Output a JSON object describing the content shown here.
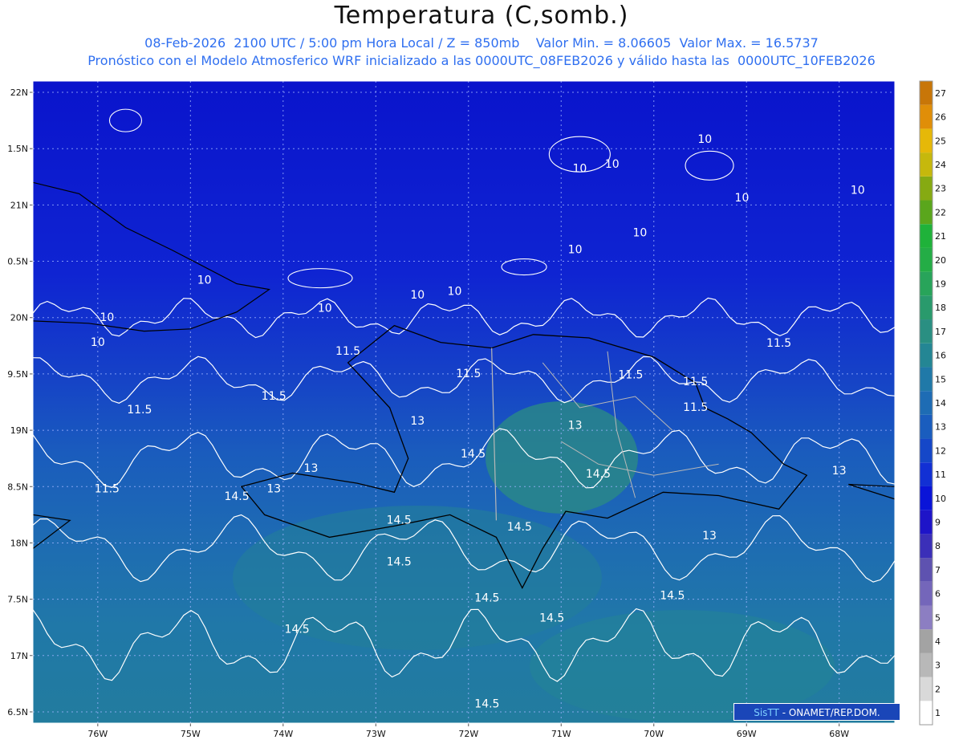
{
  "header": {
    "title": "Temperatura (C,somb.)",
    "line1": "08-Feb-2026  2100 UTC / 5:00 pm Hora Local / Z = 850mb    Valor Min. = 8.06605  Valor Max. = 16.5737",
    "line2": "Pronóstico con el Modelo Atmosferico WRF inicializado a las 0000UTC_08FEB2026 y válido hasta las  0000UTC_10FEB2026"
  },
  "map": {
    "lon_range": [
      -76.7,
      -67.4
    ],
    "lat_range": [
      16.4,
      22.1
    ],
    "lon_ticks": [
      {
        "value": -76,
        "label": "76W"
      },
      {
        "value": -75,
        "label": "75W"
      },
      {
        "value": -74,
        "label": "74W"
      },
      {
        "value": -73,
        "label": "73W"
      },
      {
        "value": -72,
        "label": "72W"
      },
      {
        "value": -71,
        "label": "71W"
      },
      {
        "value": -70,
        "label": "70W"
      },
      {
        "value": -69,
        "label": "69W"
      },
      {
        "value": -68,
        "label": "68W"
      }
    ],
    "lat_ticks": [
      {
        "value": 22,
        "label": "22N"
      },
      {
        "value": 21.5,
        "label": "1.5N"
      },
      {
        "value": 21,
        "label": "21N"
      },
      {
        "value": 20.5,
        "label": "0.5N"
      },
      {
        "value": 20,
        "label": "20N"
      },
      {
        "value": 19.5,
        "label": "9.5N"
      },
      {
        "value": 19,
        "label": "19N"
      },
      {
        "value": 18.5,
        "label": "8.5N"
      },
      {
        "value": 18,
        "label": "18N"
      },
      {
        "value": 17.5,
        "label": "7.5N"
      },
      {
        "value": 17,
        "label": "17N"
      },
      {
        "value": 16.5,
        "label": "6.5N"
      }
    ],
    "contour_labels": [
      {
        "text": "10",
        "lon": -75.9,
        "lat": 19.97
      },
      {
        "text": "10",
        "lon": -74.85,
        "lat": 20.3
      },
      {
        "text": "10",
        "lon": -73.55,
        "lat": 20.05
      },
      {
        "text": "10",
        "lon": -72.55,
        "lat": 20.17
      },
      {
        "text": "10",
        "lon": -72.15,
        "lat": 20.2
      },
      {
        "text": "10",
        "lon": -70.85,
        "lat": 20.57
      },
      {
        "text": "10",
        "lon": -70.15,
        "lat": 20.72
      },
      {
        "text": "10",
        "lon": -70.8,
        "lat": 21.29
      },
      {
        "text": "10",
        "lon": -70.45,
        "lat": 21.33
      },
      {
        "text": "10",
        "lon": -69.45,
        "lat": 21.55
      },
      {
        "text": "10",
        "lon": -69.05,
        "lat": 21.03
      },
      {
        "text": "10",
        "lon": -67.8,
        "lat": 21.1
      },
      {
        "text": "10",
        "lon": -76.0,
        "lat": 19.75
      },
      {
        "text": "11.5",
        "lon": -73.3,
        "lat": 19.67
      },
      {
        "text": "11.5",
        "lon": -72.0,
        "lat": 19.47
      },
      {
        "text": "11.5",
        "lon": -74.1,
        "lat": 19.27
      },
      {
        "text": "11.5",
        "lon": -75.55,
        "lat": 19.15
      },
      {
        "text": "11.5",
        "lon": -75.9,
        "lat": 18.45
      },
      {
        "text": "11.5",
        "lon": -70.25,
        "lat": 19.46
      },
      {
        "text": "11.5",
        "lon": -69.55,
        "lat": 19.4
      },
      {
        "text": "11.5",
        "lon": -69.55,
        "lat": 19.17
      },
      {
        "text": "11.5",
        "lon": -68.65,
        "lat": 19.74
      },
      {
        "text": "13",
        "lon": -72.55,
        "lat": 19.05
      },
      {
        "text": "13",
        "lon": -70.85,
        "lat": 19.01
      },
      {
        "text": "13",
        "lon": -73.7,
        "lat": 18.63
      },
      {
        "text": "13",
        "lon": -74.1,
        "lat": 18.45
      },
      {
        "text": "13",
        "lon": -69.4,
        "lat": 18.03
      },
      {
        "text": "13",
        "lon": -68.0,
        "lat": 18.61
      },
      {
        "text": "14.5",
        "lon": -71.95,
        "lat": 18.76
      },
      {
        "text": "14.5",
        "lon": -70.6,
        "lat": 18.58
      },
      {
        "text": "14.5",
        "lon": -74.5,
        "lat": 18.38
      },
      {
        "text": "14.5",
        "lon": -72.75,
        "lat": 18.17
      },
      {
        "text": "14.5",
        "lon": -71.45,
        "lat": 18.11
      },
      {
        "text": "14.5",
        "lon": -72.75,
        "lat": 17.8
      },
      {
        "text": "14.5",
        "lon": -71.8,
        "lat": 17.48
      },
      {
        "text": "14.5",
        "lon": -71.1,
        "lat": 17.3
      },
      {
        "text": "14.5",
        "lon": -69.8,
        "lat": 17.5
      },
      {
        "text": "14.5",
        "lon": -73.85,
        "lat": 17.2
      },
      {
        "text": "14.5",
        "lon": -71.8,
        "lat": 16.54
      }
    ],
    "coast_hispaniola": [
      [
        -71.75,
        19.73
      ],
      [
        -71.3,
        19.85
      ],
      [
        -70.7,
        19.82
      ],
      [
        -70.0,
        19.65
      ],
      [
        -69.55,
        19.42
      ],
      [
        -69.45,
        19.2
      ],
      [
        -69.2,
        19.1
      ],
      [
        -68.95,
        18.98
      ],
      [
        -68.6,
        18.7
      ],
      [
        -68.35,
        18.6
      ],
      [
        -68.65,
        18.3
      ],
      [
        -69.3,
        18.42
      ],
      [
        -69.9,
        18.45
      ],
      [
        -70.5,
        18.22
      ],
      [
        -70.95,
        18.28
      ],
      [
        -71.2,
        17.95
      ],
      [
        -71.42,
        17.6
      ],
      [
        -71.7,
        18.05
      ],
      [
        -72.2,
        18.25
      ],
      [
        -72.8,
        18.15
      ],
      [
        -73.5,
        18.05
      ],
      [
        -74.2,
        18.25
      ],
      [
        -74.45,
        18.5
      ],
      [
        -73.9,
        18.62
      ],
      [
        -73.2,
        18.53
      ],
      [
        -72.8,
        18.45
      ],
      [
        -72.65,
        18.75
      ],
      [
        -72.85,
        19.2
      ],
      [
        -73.3,
        19.6
      ],
      [
        -72.8,
        19.93
      ],
      [
        -72.3,
        19.78
      ],
      [
        -71.75,
        19.73
      ]
    ],
    "coast_cuba": [
      [
        -76.7,
        19.97
      ],
      [
        -76.1,
        19.95
      ],
      [
        -75.5,
        19.88
      ],
      [
        -75.0,
        19.9
      ],
      [
        -74.5,
        20.05
      ],
      [
        -74.15,
        20.25
      ],
      [
        -74.5,
        20.3
      ],
      [
        -75.2,
        20.6
      ],
      [
        -75.7,
        20.8
      ],
      [
        -76.2,
        21.1
      ],
      [
        -76.7,
        21.2
      ]
    ],
    "coast_puerto_rico": [
      [
        -67.9,
        18.52
      ],
      [
        -66.9,
        18.48
      ],
      [
        -66.1,
        18.45
      ],
      [
        -65.7,
        18.32
      ],
      [
        -65.8,
        18.0
      ],
      [
        -66.6,
        17.95
      ],
      [
        -67.2,
        17.98
      ],
      [
        -67.25,
        18.35
      ],
      [
        -67.9,
        18.52
      ]
    ],
    "coast_jamaica": [
      [
        -76.7,
        18.25
      ],
      [
        -76.3,
        18.2
      ],
      [
        -76.7,
        17.95
      ]
    ]
  },
  "colorbar": {
    "levels": [
      1,
      2,
      3,
      4,
      5,
      6,
      7,
      8,
      9,
      10,
      11,
      12,
      13,
      14,
      15,
      16,
      17,
      18,
      19,
      20,
      21,
      22,
      23,
      24,
      25,
      26,
      27
    ],
    "colors": [
      "#ffffff",
      "#d9d9d9",
      "#b8b8b8",
      "#a3a3a3",
      "#8c7ec2",
      "#7466ba",
      "#5e52b0",
      "#3b2fb8",
      "#1e14c8",
      "#0a14d8",
      "#1230d4",
      "#1547c8",
      "#1a5dbe",
      "#1e6cb4",
      "#2079a8",
      "#248694",
      "#2a8f82",
      "#299a6c",
      "#28a45a",
      "#24ad46",
      "#1fb23a",
      "#5aa61c",
      "#86aa12",
      "#c6b80c",
      "#e6b808",
      "#e08e08",
      "#c87608"
    ]
  },
  "credit": {
    "brand": "SisTT",
    "text": " - ONAMET/REP.DOM."
  }
}
